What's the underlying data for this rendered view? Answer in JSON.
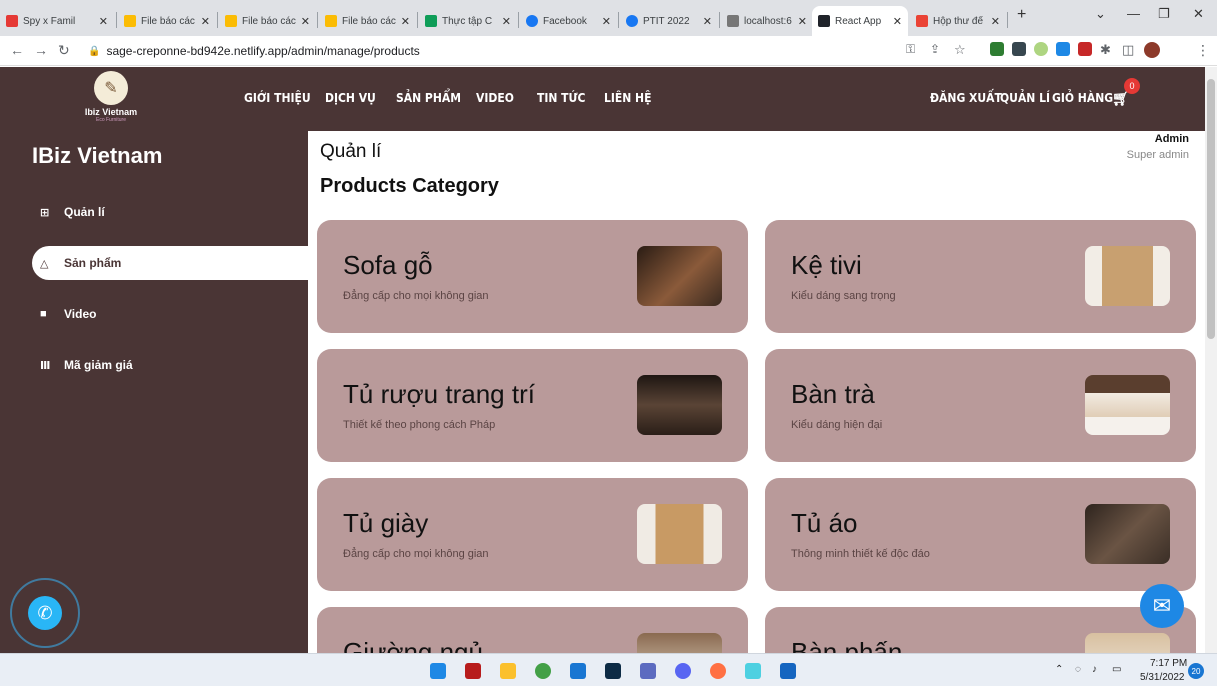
{
  "browser": {
    "tabs": [
      {
        "title": "Spy x Famil",
        "color": "#e53935"
      },
      {
        "title": "File báo các",
        "color": "#fbbc04"
      },
      {
        "title": "File báo các",
        "color": "#fbbc04"
      },
      {
        "title": "File báo các",
        "color": "#fbbc04"
      },
      {
        "title": "Thực tập C",
        "color": "#0f9d58"
      },
      {
        "title": "Facebook",
        "color": "#1877f2"
      },
      {
        "title": "PTIT 2022",
        "color": "#1877f2"
      },
      {
        "title": "localhost:6",
        "color": "#777777"
      },
      {
        "title": "React App",
        "color": "#20232a"
      },
      {
        "title": "Hộp thư đế",
        "color": "#ea4335"
      }
    ],
    "url": "sage-creponne-bd942e.netlify.app/admin/manage/products"
  },
  "header": {
    "logo_line1": "Ibiz Vietnam",
    "logo_line2": "Eco Furniture",
    "menu": [
      "GIỚI THIỆU",
      "DỊCH VỤ",
      "SẢN PHẨM",
      "VIDEO",
      "TIN TỨC",
      "LIÊN HỆ"
    ],
    "right": [
      "ĐĂNG XUẤT",
      "QUẢN LÍ",
      "GIỎ HÀNG"
    ],
    "cart_count": "0"
  },
  "sidebar": {
    "brand": "IBiz Vietnam",
    "items": [
      {
        "label": "Quản lí",
        "icon": "⊞"
      },
      {
        "label": "Sản phẩm",
        "icon": "△"
      },
      {
        "label": "Video",
        "icon": "■"
      },
      {
        "label": "Mã giảm giá",
        "icon": "Ⅲ"
      }
    ]
  },
  "main": {
    "title": "Quản lí",
    "subtitle": "Products Category",
    "user_name": "Admin",
    "user_role": "Super admin",
    "cards": [
      {
        "title": "Sofa gỗ",
        "desc": "Đẳng cấp cho mọi không gian",
        "img": "#5a3a2a"
      },
      {
        "title": "Kệ tivi",
        "desc": "Kiểu dáng sang trọng",
        "img": "#c8a070"
      },
      {
        "title": "Tủ rượu trang trí",
        "desc": "Thiết kế theo phong cách Pháp",
        "img": "#3a2a22"
      },
      {
        "title": "Bàn trà",
        "desc": "Kiểu dáng hiện đại",
        "img": "#e8ddd0"
      },
      {
        "title": "Tủ giày",
        "desc": "Đẳng cấp cho mọi không gian",
        "img": "#c89a64"
      },
      {
        "title": "Tủ áo",
        "desc": "Thông minh thiết kế độc đáo",
        "img": "#4a3a30"
      },
      {
        "title": "Giường ngủ",
        "desc": "",
        "img": "#6a5040"
      },
      {
        "title": "Bàn phấn",
        "desc": "",
        "img": "#d8c0a0"
      }
    ]
  },
  "taskbar": {
    "time": "7:17 PM",
    "date": "5/31/2022",
    "notifications": "20"
  }
}
